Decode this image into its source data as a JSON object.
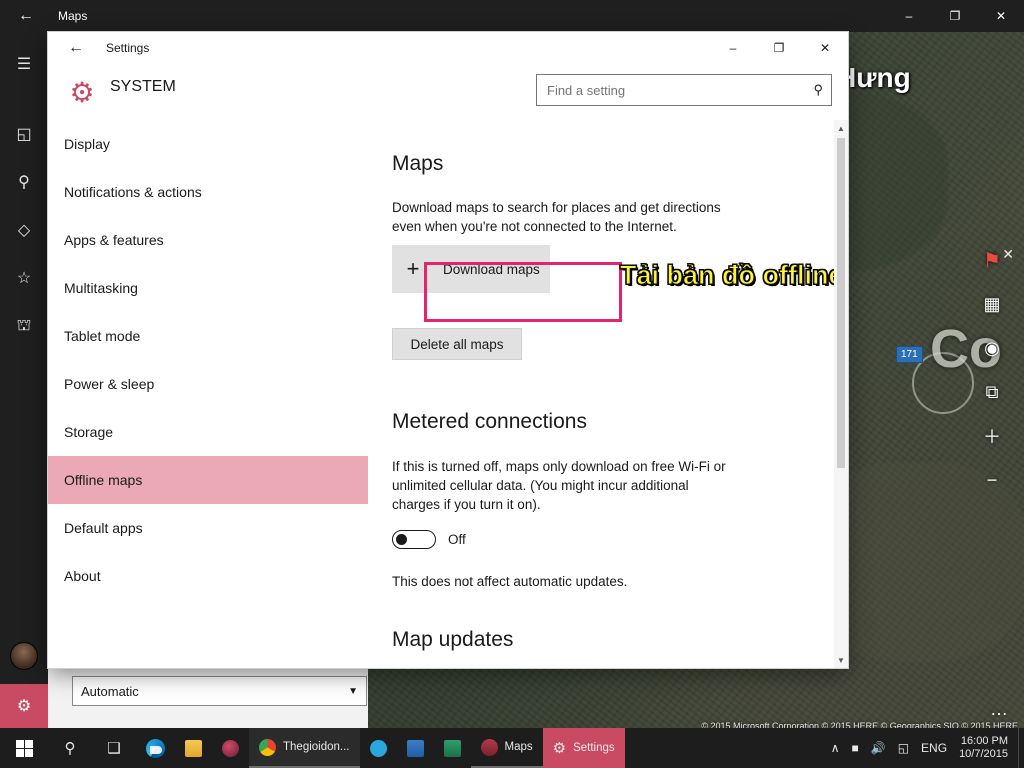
{
  "maps_window": {
    "title": "Maps",
    "back_icon": "back-arrow-icon",
    "minimize": "–",
    "maximize": "❐",
    "close": "✕",
    "rail": [
      {
        "name": "hamburger-menu",
        "glyph": "☰"
      },
      {
        "name": "map-view",
        "glyph": "◱"
      },
      {
        "name": "search",
        "glyph": "⚲"
      },
      {
        "name": "directions",
        "glyph": "◇"
      },
      {
        "name": "favorites",
        "glyph": "☆"
      },
      {
        "name": "3d-cities",
        "glyph": "⛫"
      }
    ],
    "map": {
      "label_primary": "Hưng",
      "label_secondary": "Co",
      "badge": "171",
      "copyright": "© 2015 Microsoft Corporation  © 2015 HERE  © Geographics SIO  © 2015 HERE",
      "ellipsis": "…"
    },
    "controls": [
      {
        "name": "compass-pin-icon",
        "glyph": "⚑"
      },
      {
        "name": "grid-icon",
        "glyph": "▦"
      },
      {
        "name": "locate-me-icon",
        "glyph": "◉"
      },
      {
        "name": "layers-icon",
        "glyph": "⧉"
      },
      {
        "name": "zoom-in-icon",
        "glyph": "＋"
      },
      {
        "name": "zoom-out-icon",
        "glyph": "−"
      }
    ],
    "close_control": "✕",
    "background_combo": {
      "value": "Automatic"
    }
  },
  "settings_window": {
    "titlebar": {
      "back_icon": "back-arrow-icon",
      "title": "Settings",
      "minimize": "–",
      "maximize": "❐",
      "close": "✕"
    },
    "header": {
      "gear_icon": "gear-icon",
      "category": "SYSTEM"
    },
    "search": {
      "placeholder": "Find a setting",
      "icon": "search-icon"
    },
    "sidebar": {
      "items": [
        {
          "label": "Display",
          "selected": false
        },
        {
          "label": "Notifications & actions",
          "selected": false
        },
        {
          "label": "Apps & features",
          "selected": false
        },
        {
          "label": "Multitasking",
          "selected": false
        },
        {
          "label": "Tablet mode",
          "selected": false
        },
        {
          "label": "Power & sleep",
          "selected": false
        },
        {
          "label": "Storage",
          "selected": false
        },
        {
          "label": "Offline maps",
          "selected": true
        },
        {
          "label": "Default apps",
          "selected": false
        },
        {
          "label": "About",
          "selected": false
        }
      ]
    },
    "main": {
      "maps_heading": "Maps",
      "maps_description": "Download maps to search for places and get directions even when you're not connected to the Internet.",
      "download_maps_label": "Download maps",
      "download_plus_icon": "plus-icon",
      "delete_all_maps_label": "Delete all maps",
      "metered_heading": "Metered connections",
      "metered_description": "If this is turned off, maps only download on free Wi-Fi or unlimited cellular data. (You might incur additional charges if you turn it on).",
      "metered_toggle_state": "Off",
      "auto_updates_note": "This does not affect automatic updates.",
      "map_updates_heading": "Map updates"
    },
    "annotation": {
      "highlight_box_color": "#e8236d",
      "callout_text": "Tải bản đồ offline",
      "callout_color": "#fff33a"
    },
    "scrollbar": {
      "up_arrow": "▲",
      "down_arrow": "▼"
    }
  },
  "taskbar": {
    "start_label": "start-button",
    "search_icon": "⚲",
    "taskview_icon": "❑",
    "apps": [
      {
        "label": "",
        "name": "taskbar-edge",
        "icon": "edge-icon"
      },
      {
        "label": "",
        "name": "taskbar-file-explorer",
        "icon": "folder-icon"
      },
      {
        "label": "",
        "name": "taskbar-app-unknown",
        "icon": "app-icon"
      },
      {
        "label": "Thegioidon...",
        "name": "taskbar-chrome-thegioidon",
        "icon": "chrome-icon"
      },
      {
        "label": "",
        "name": "taskbar-skype",
        "icon": "skype-icon"
      },
      {
        "label": "",
        "name": "taskbar-word",
        "icon": "word-icon"
      },
      {
        "label": "",
        "name": "taskbar-mail",
        "icon": "mail-icon"
      },
      {
        "label": "Maps",
        "name": "taskbar-maps",
        "icon": "maps-icon"
      },
      {
        "label": "Settings",
        "name": "taskbar-settings",
        "icon": "gear-icon"
      }
    ],
    "tray": {
      "chevron": "∧",
      "icons": [
        "▢",
        "ὐA",
        "⎙"
      ],
      "language": "ENG",
      "time": "16:00 PM",
      "date": "10/7/2015"
    }
  }
}
